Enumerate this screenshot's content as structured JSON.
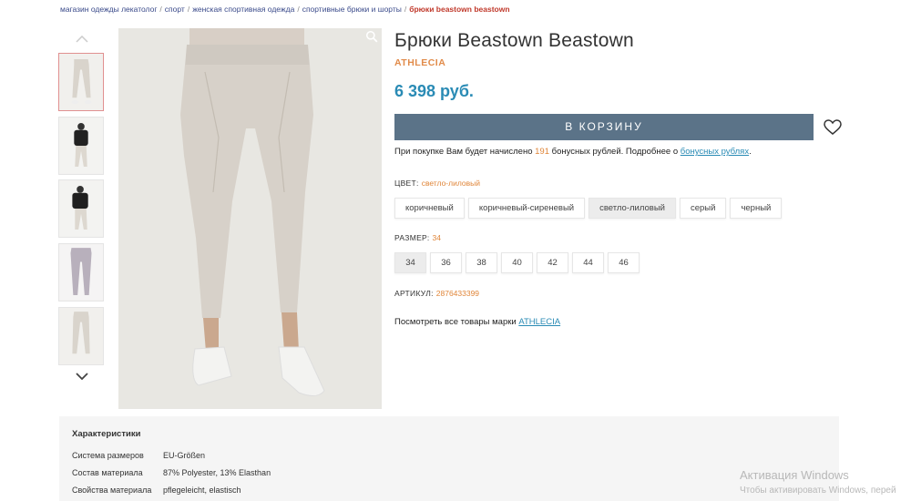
{
  "breadcrumb": {
    "items": [
      "магазин одежды лекатолог",
      "спорт",
      "женская спортивная одежда",
      "спортивные брюки и шорты"
    ],
    "current": "брюки beastown beastown",
    "separator": "/"
  },
  "gallery": {
    "up_icon": "chevron-up-icon",
    "down_icon": "chevron-down-icon",
    "zoom_icon": "zoom-icon"
  },
  "product": {
    "title": "Брюки Beastown Beastown",
    "brand": "ATHLECIA",
    "price": "6 398 руб.",
    "cart_button": "В КОРЗИНУ",
    "bonus": {
      "prefix": "При покупке Вам будет начислено ",
      "amount": "191",
      "middle": " бонусных рублей. Подробнее о ",
      "link": "бонусных рублях",
      "suffix": "."
    },
    "color_label": "ЦВЕТ:",
    "color_value": "светло-лиловый",
    "colors": [
      "коричневый",
      "коричневый-сиреневый",
      "светло-лиловый",
      "серый",
      "черный"
    ],
    "selected_color_index": 2,
    "size_label": "РАЗМЕР:",
    "size_value": "34",
    "sizes": [
      "34",
      "36",
      "38",
      "40",
      "42",
      "44",
      "46"
    ],
    "selected_size_index": 0,
    "article_label": "АРТИКУЛ:",
    "article_value": "2876433399",
    "brand_link_prefix": "Посмотреть все товары марки ",
    "brand_link": "ATHLECIA"
  },
  "specs": {
    "title": "Характеристики",
    "rows": [
      {
        "key": "Система размеров",
        "value": "EU-Größen"
      },
      {
        "key": "Состав материала",
        "value": "87% Polyester, 13% Elasthan"
      },
      {
        "key": "Свойства материала",
        "value": "pflegeleicht, elastisch"
      }
    ]
  },
  "overlay": {
    "line1": "Активация Windows",
    "line2": "Чтобы активировать Windows, перей"
  },
  "colors": {
    "accent_blue": "#2a8bb5",
    "brand_orange": "#e18b4a",
    "button_bg": "#5b7388",
    "breadcrumb_current": "#c0392b"
  }
}
